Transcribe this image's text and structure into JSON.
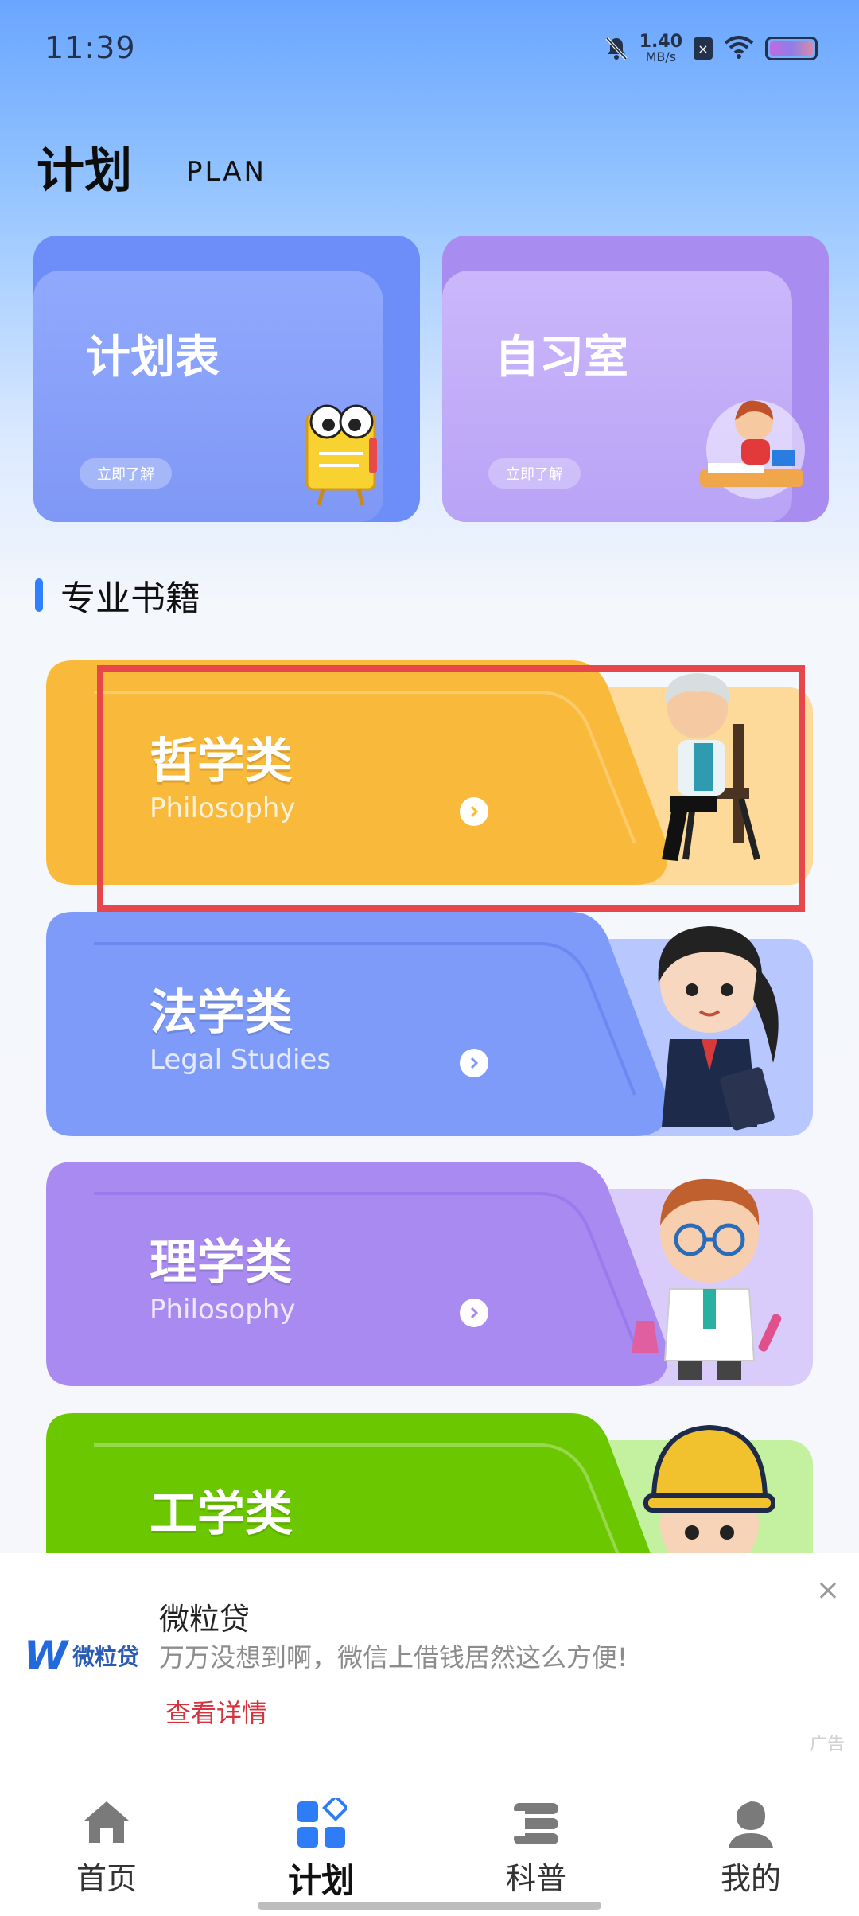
{
  "status_bar": {
    "time": "11:39",
    "net_speed_value": "1.40",
    "net_speed_unit": "MB/s",
    "sim_label": "×",
    "icons": [
      "mute-icon",
      "sim-icon",
      "wifi-icon",
      "battery-icon"
    ]
  },
  "header": {
    "title": "计划",
    "subtitle": "PLAN"
  },
  "top_cards": [
    {
      "title": "计划表",
      "button": "立即了解",
      "color": "#6d8ef9"
    },
    {
      "title": "自习室",
      "button": "立即了解",
      "color": "#a98cf0"
    }
  ],
  "section": {
    "title": "专业书籍",
    "accent": "#2f80ff"
  },
  "categories": [
    {
      "title": "哲学类",
      "subtitle": "Philosophy",
      "color": "#f9b93a"
    },
    {
      "title": "法学类",
      "subtitle": "Legal Studies",
      "color": "#7e9bfa"
    },
    {
      "title": "理学类",
      "subtitle": "Philosophy",
      "color": "#a88af0"
    },
    {
      "title": "工学类",
      "subtitle": "",
      "color": "#6bc800"
    }
  ],
  "ad": {
    "logo_text": "微粒贷",
    "title": "微粒贷",
    "description": "万万没想到啊，微信上借钱居然这么方便!",
    "link": "查看详情",
    "close": "×",
    "tag": "广告"
  },
  "bottom_nav": [
    {
      "label": "首页",
      "icon": "home-icon",
      "active": false
    },
    {
      "label": "计划",
      "icon": "plan-icon",
      "active": true
    },
    {
      "label": "科普",
      "icon": "science-icon",
      "active": false
    },
    {
      "label": "我的",
      "icon": "profile-icon",
      "active": false
    }
  ],
  "colors": {
    "highlight": "#e8464d",
    "nav_active": "#2f7df6"
  }
}
